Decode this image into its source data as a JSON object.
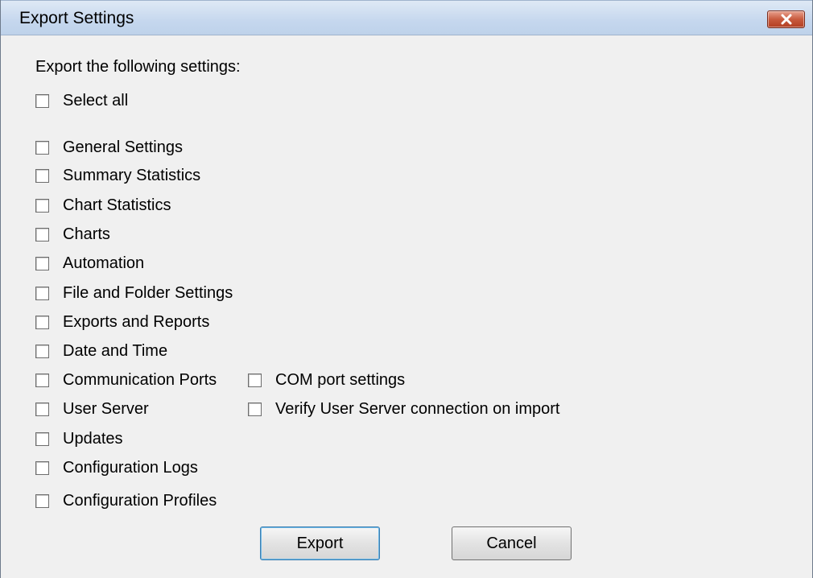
{
  "window": {
    "title": "Export Settings"
  },
  "intro_text": "Export the following settings:",
  "select_all_label": "Select all",
  "settings": [
    "General Settings",
    "Summary Statistics",
    "Chart Statistics",
    "Charts",
    "Automation",
    "File and Folder Settings",
    "Exports and Reports",
    "Date and Time",
    "Communication Ports",
    "User Server",
    "Updates",
    "Configuration Logs",
    "Configuration Profiles"
  ],
  "sub_options": {
    "com_port": "COM port settings",
    "verify_user_server": "Verify User Server connection on import"
  },
  "buttons": {
    "export": "Export",
    "cancel": "Cancel"
  }
}
